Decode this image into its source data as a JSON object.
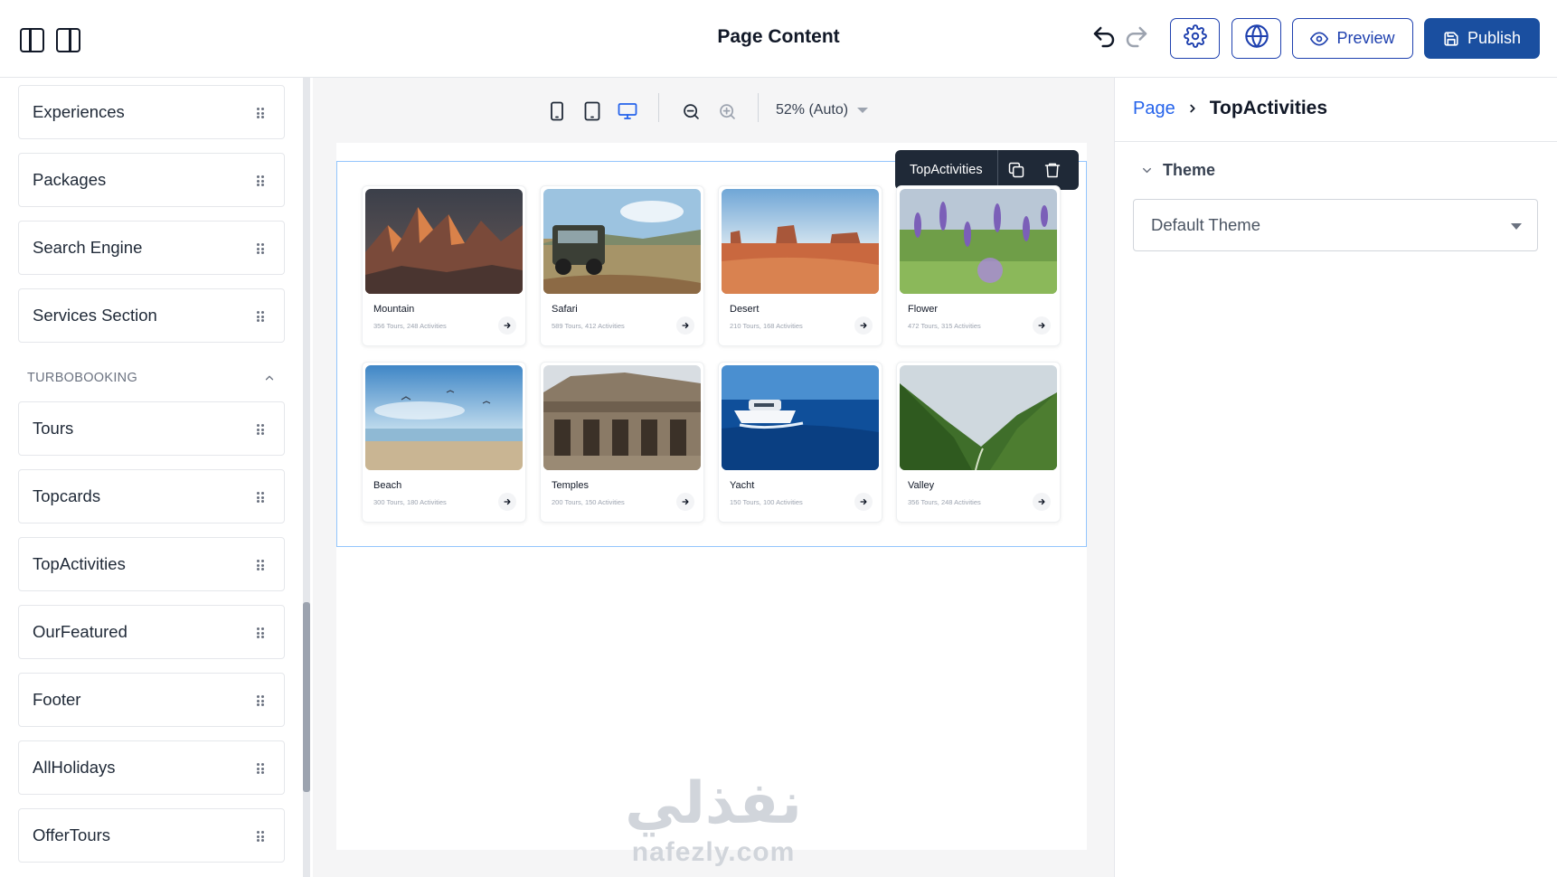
{
  "header": {
    "title": "Page Content",
    "preview_label": "Preview",
    "publish_label": "Publish"
  },
  "sidebar": {
    "items_top": [
      {
        "label": "Experiences"
      },
      {
        "label": "Packages"
      },
      {
        "label": "Search Engine"
      },
      {
        "label": "Services Section"
      }
    ],
    "section_title": "TURBOBOOKING",
    "items_section": [
      {
        "label": "Tours"
      },
      {
        "label": "Topcards"
      },
      {
        "label": "TopActivities"
      },
      {
        "label": "OurFeatured"
      },
      {
        "label": "Footer"
      },
      {
        "label": "AllHolidays"
      },
      {
        "label": "OfferTours"
      }
    ]
  },
  "canvas": {
    "zoom_label": "52% (Auto)",
    "selected_block": "TopActivities",
    "cards": [
      {
        "title": "Mountain",
        "subtitle": "356 Tours, 248 Activities",
        "image": "mountain-image"
      },
      {
        "title": "Safari",
        "subtitle": "589 Tours, 412 Activities",
        "image": "safari-image"
      },
      {
        "title": "Desert",
        "subtitle": "210 Tours, 168 Activities",
        "image": "desert-image"
      },
      {
        "title": "Flower",
        "subtitle": "472 Tours, 315 Activities",
        "image": "flower-image"
      },
      {
        "title": "Beach",
        "subtitle": "300 Tours, 180 Activities",
        "image": "beach-image"
      },
      {
        "title": "Temples",
        "subtitle": "200 Tours, 150 Activities",
        "image": "temples-image"
      },
      {
        "title": "Yacht",
        "subtitle": "150 Tours, 100 Activities",
        "image": "yacht-image"
      },
      {
        "title": "Valley",
        "subtitle": "356 Tours, 248 Activities",
        "image": "valley-image"
      }
    ],
    "watermark_ar": "نفذلي",
    "watermark_en": "nafezly.com"
  },
  "right_panel": {
    "breadcrumb_root": "Page",
    "breadcrumb_current": "TopActivities",
    "theme_section_label": "Theme",
    "theme_value": "Default Theme"
  },
  "colors": {
    "primary": "#1a4fa0",
    "accent_blue": "#2563eb",
    "selection_outline": "#93c5fd",
    "toolbar_dark": "#1f2937"
  },
  "icons": [
    "left-panel-icon",
    "right-panel-icon",
    "undo-icon",
    "redo-icon",
    "settings-icon",
    "globe-icon",
    "eye-icon",
    "save-icon",
    "mobile-icon",
    "tablet-icon",
    "desktop-icon",
    "zoom-out-icon",
    "zoom-in-icon",
    "chevron-down-icon",
    "drag-handle-icon",
    "copy-icon",
    "trash-icon",
    "arrow-right-icon",
    "chevron-up-icon",
    "chevron-right-icon"
  ]
}
